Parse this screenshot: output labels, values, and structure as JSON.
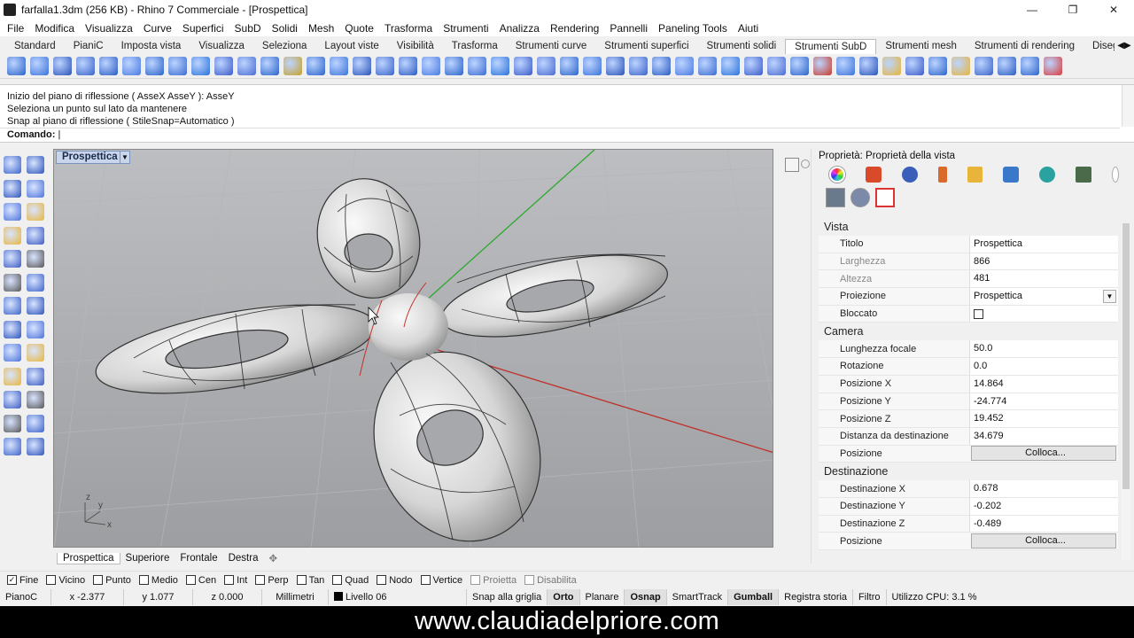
{
  "window": {
    "title": "farfalla1.3dm (256 KB) - Rhino 7 Commerciale - [Prospettica]",
    "controls": [
      "—",
      "❐",
      "✕"
    ]
  },
  "menu": [
    "File",
    "Modifica",
    "Visualizza",
    "Curve",
    "Superfici",
    "SubD",
    "Solidi",
    "Mesh",
    "Quote",
    "Trasforma",
    "Strumenti",
    "Analizza",
    "Rendering",
    "Pannelli",
    "Paneling Tools",
    "Aiuti"
  ],
  "toolbar_tabs": [
    "Standard",
    "PianiC",
    "Imposta vista",
    "Visualizza",
    "Seleziona",
    "Layout viste",
    "Visibilità",
    "Trasforma",
    "Strumenti curve",
    "Strumenti superfici",
    "Strumenti solidi",
    "Strumenti SubD",
    "Strumenti mesh",
    "Strumenti di rendering",
    "Disegno tec"
  ],
  "toolbar_active_tab": "Strumenti SubD",
  "command_history": [
    "Inizio del piano di riflessione ( AsseX  AsseY ): AsseY",
    "Seleziona un punto sul lato da mantenere",
    "Snap al piano di riflessione ( StileSnap=Automatico )"
  ],
  "command_prompt": "Comando:",
  "viewport": {
    "title": "Prospettica",
    "axis_labels": [
      "z",
      "y",
      "x"
    ]
  },
  "viewport_tabs": [
    "Prospettica",
    "Superiore",
    "Frontale",
    "Destra",
    "✥"
  ],
  "panel": {
    "title": "Proprietà: Proprietà della vista",
    "sections": {
      "vista": "Vista",
      "camera": "Camera",
      "destinazione": "Destinazione"
    },
    "vista_rows": [
      {
        "label": "Titolo",
        "value": "Prospettica"
      },
      {
        "label": "Larghezza",
        "value": "866"
      },
      {
        "label": "Altezza",
        "value": "481"
      },
      {
        "label": "Proiezione",
        "value": "Prospettica"
      },
      {
        "label": "Bloccato",
        "value": ""
      }
    ],
    "camera_rows": [
      {
        "label": "Lunghezza focale",
        "value": "50.0"
      },
      {
        "label": "Rotazione",
        "value": "0.0"
      },
      {
        "label": "Posizione X",
        "value": "14.864"
      },
      {
        "label": "Posizione Y",
        "value": "-24.774"
      },
      {
        "label": "Posizione Z",
        "value": "19.452"
      },
      {
        "label": "Distanza da destinazione",
        "value": "34.679"
      },
      {
        "label": "Posizione",
        "value": "Colloca..."
      }
    ],
    "dest_rows": [
      {
        "label": "Destinazione X",
        "value": "0.678"
      },
      {
        "label": "Destinazione Y",
        "value": "-0.202"
      },
      {
        "label": "Destinazione Z",
        "value": "-0.489"
      },
      {
        "label": "Posizione",
        "value": "Colloca..."
      }
    ]
  },
  "osnaps": [
    {
      "label": "Fine",
      "checked": true
    },
    {
      "label": "Vicino",
      "checked": false
    },
    {
      "label": "Punto",
      "checked": false
    },
    {
      "label": "Medio",
      "checked": false
    },
    {
      "label": "Cen",
      "checked": false
    },
    {
      "label": "Int",
      "checked": false
    },
    {
      "label": "Perp",
      "checked": false
    },
    {
      "label": "Tan",
      "checked": false
    },
    {
      "label": "Quad",
      "checked": false
    },
    {
      "label": "Nodo",
      "checked": false
    },
    {
      "label": "Vertice",
      "checked": false
    },
    {
      "label": "Proietta",
      "checked": false,
      "disabled": true
    },
    {
      "label": "Disabilita",
      "checked": false,
      "disabled": true
    }
  ],
  "status": {
    "cplane": "PianoC",
    "x": "x -2.377",
    "y": "y 1.077",
    "z": "z 0.000",
    "units": "Millimetri",
    "layer": "Livello 06",
    "snap": "Snap alla griglia",
    "orto": "Orto",
    "planare": "Planare",
    "osnap": "Osnap",
    "smarttrack": "SmartTrack",
    "gumball": "Gumball",
    "history": "Registra storia",
    "filter": "Filtro",
    "cpu": "Utilizzo CPU: 3.1 %"
  },
  "banner": "www.claudiadelpriore.com"
}
